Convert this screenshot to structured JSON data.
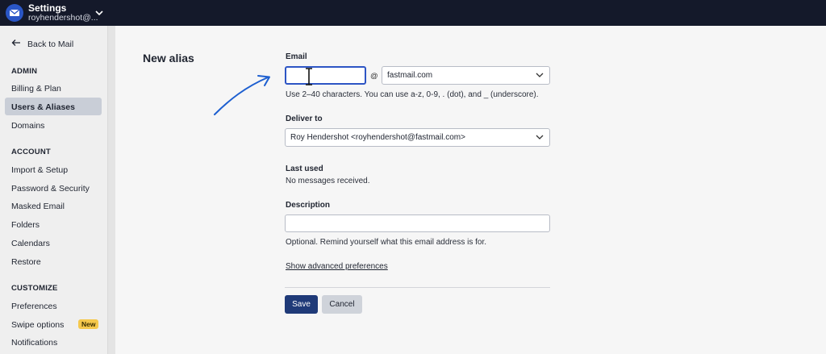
{
  "header": {
    "title": "Settings",
    "user": "royhendershot@..."
  },
  "sidebar": {
    "back_label": "Back to Mail",
    "sections": [
      {
        "title": "ADMIN",
        "items": [
          "Billing & Plan",
          "Users & Aliases",
          "Domains"
        ]
      },
      {
        "title": "ACCOUNT",
        "items": [
          "Import & Setup",
          "Password & Security",
          "Masked Email",
          "Folders",
          "Calendars",
          "Restore"
        ]
      },
      {
        "title": "CUSTOMIZE",
        "items": [
          "Preferences",
          "Swipe options",
          "Notifications"
        ]
      }
    ],
    "active_item": "Users & Aliases",
    "new_badge": "New"
  },
  "form": {
    "page_title": "New alias",
    "email_label": "Email",
    "email_value": "",
    "at_sign": "@",
    "domain_value": "fastmail.com",
    "email_hint": "Use 2–40 characters. You can use a-z, 0-9, . (dot), and _ (underscore).",
    "deliver_label": "Deliver to",
    "deliver_value": "Roy Hendershot <royhendershot@fastmail.com>",
    "last_used_label": "Last used",
    "last_used_value": "No messages received.",
    "description_label": "Description",
    "description_value": "",
    "description_hint": "Optional. Remind yourself what this email address is for.",
    "advanced_link": "Show advanced preferences",
    "save_label": "Save",
    "cancel_label": "Cancel"
  },
  "colors": {
    "topbar": "#14192a",
    "accent": "#2d55c4",
    "save_button": "#1f3a78",
    "annotation_arrow": "#1d5fd0"
  }
}
